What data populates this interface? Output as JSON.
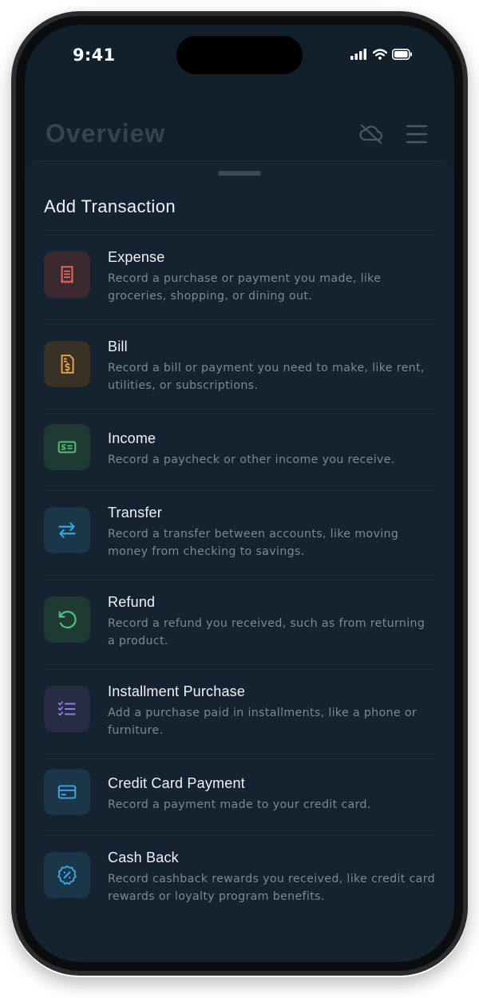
{
  "status_bar": {
    "time": "9:41",
    "icons": [
      "cellular-signal-icon",
      "wifi-icon",
      "battery-icon"
    ]
  },
  "header": {
    "title": "Overview",
    "icons": [
      "cloud-off-icon",
      "menu-icon"
    ]
  },
  "sheet": {
    "title": "Add Transaction",
    "items": [
      {
        "title": "Expense",
        "description": "Record a purchase or payment you made, like groceries, shopping, or dining out.",
        "icon": "receipt-icon",
        "color": "#e0675a"
      },
      {
        "title": "Bill",
        "description": "Record a bill or payment you need to make, like rent, utilities, or subscriptions.",
        "icon": "bill-document-icon",
        "color": "#e8a64a"
      },
      {
        "title": "Income",
        "description": "Record a paycheck or other income you receive.",
        "icon": "cash-icon",
        "color": "#4dc07a"
      },
      {
        "title": "Transfer",
        "description": "Record a transfer between accounts, like moving money from checking to savings.",
        "icon": "transfer-arrows-icon",
        "color": "#3da8e6"
      },
      {
        "title": "Refund",
        "description": "Record a refund you received, such as from returning a product.",
        "icon": "refund-undo-icon",
        "color": "#4dc07a"
      },
      {
        "title": "Installment Purchase",
        "description": "Add a purchase paid in installments, like a phone or furniture.",
        "icon": "checklist-icon",
        "color": "#8a7fe0"
      },
      {
        "title": "Credit Card Payment",
        "description": "Record a payment made to your credit card.",
        "icon": "credit-card-icon",
        "color": "#3da8e6"
      },
      {
        "title": "Cash Back",
        "description": "Record cashback rewards you received, like credit card rewards or loyalty program benefits.",
        "icon": "cashback-badge-icon",
        "color": "#3da8e6"
      }
    ]
  }
}
